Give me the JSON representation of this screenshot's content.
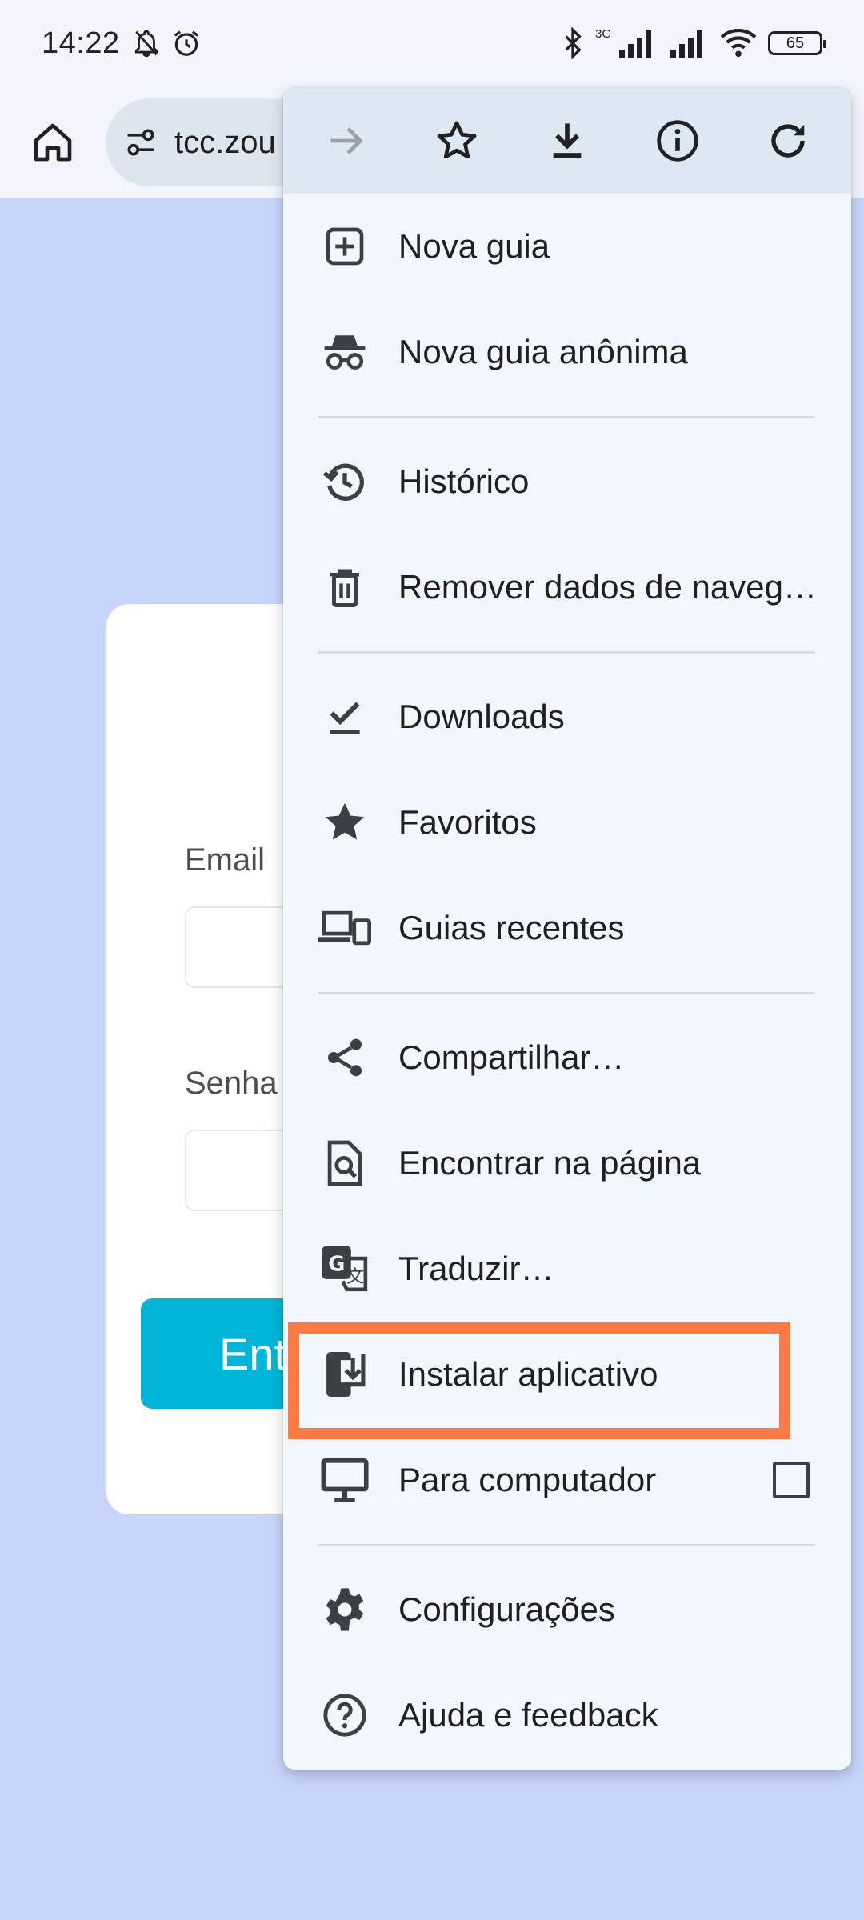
{
  "status_bar": {
    "time": "14:22",
    "network_label": "3G",
    "battery_level": "65"
  },
  "toolbar": {
    "url_text": "tcc.zou"
  },
  "page": {
    "email_label": "Email",
    "password_label": "Senha",
    "enter_button_label": "Ent"
  },
  "menu": {
    "top_icons": [
      "forward-icon",
      "bookmark-star-icon",
      "download-icon",
      "info-icon",
      "reload-icon"
    ],
    "items": [
      {
        "label": "Nova guia",
        "icon": "new-tab-icon"
      },
      {
        "label": "Nova guia anônima",
        "icon": "incognito-icon"
      },
      {
        "label": "Histórico",
        "icon": "history-icon"
      },
      {
        "label": "Remover dados de naveg…",
        "icon": "trash-icon"
      },
      {
        "label": "Downloads",
        "icon": "downloads-icon"
      },
      {
        "label": "Favoritos",
        "icon": "star-icon"
      },
      {
        "label": "Guias recentes",
        "icon": "devices-icon"
      },
      {
        "label": "Compartilhar…",
        "icon": "share-icon"
      },
      {
        "label": "Encontrar na página",
        "icon": "find-in-page-icon"
      },
      {
        "label": "Traduzir…",
        "icon": "translate-icon"
      },
      {
        "label": "Instalar aplicativo",
        "icon": "install-app-icon"
      },
      {
        "label": "Para computador",
        "icon": "desktop-icon",
        "checkbox_checked": false
      },
      {
        "label": "Configurações",
        "icon": "settings-icon"
      },
      {
        "label": "Ajuda e feedback",
        "icon": "help-icon"
      }
    ]
  },
  "colors": {
    "page_background": "#c7d5fb",
    "menu_background": "#f2f7fd",
    "highlight_border": "#ff7a45",
    "enter_button": "#00b5d8"
  }
}
